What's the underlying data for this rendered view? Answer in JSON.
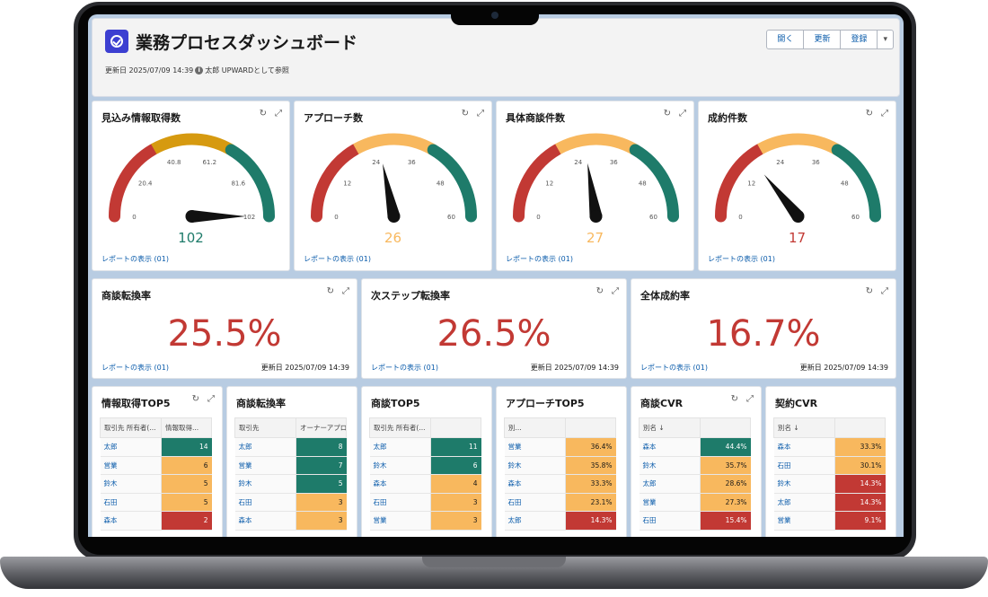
{
  "colors": {
    "red": "#c23934",
    "orange": "#f8b85e",
    "green": "#1e7b6a",
    "gold": "#d69a10",
    "link": "#0b5cab"
  },
  "header": {
    "title": "業務プロセスダッシュボード",
    "updated": "更新日 2025/07/09 14:39",
    "viewer": "太郎 UPWARDとして参照",
    "buttons": {
      "open": "開く",
      "refresh": "更新",
      "subscribe": "登録"
    }
  },
  "link_label": "レポートの表示 (01)",
  "date_label": "更新日 2025/07/09 14:39",
  "gauges": [
    {
      "title": "見込み情報取得数",
      "value": 102,
      "display": "102",
      "min": 0,
      "max": 102,
      "ticks": [
        "0",
        "20.4",
        "40.8",
        "61.2",
        "81.6",
        "102"
      ],
      "segments": [
        "red",
        "gold",
        "green"
      ],
      "value_color": "green"
    },
    {
      "title": "アプローチ数",
      "value": 26,
      "display": "26",
      "min": 0,
      "max": 60,
      "ticks": [
        "0",
        "12",
        "24",
        "36",
        "48",
        "60"
      ],
      "segments": [
        "red",
        "orange",
        "green"
      ],
      "value_color": "orange"
    },
    {
      "title": "具体商談件数",
      "value": 27,
      "display": "27",
      "min": 0,
      "max": 60,
      "ticks": [
        "0",
        "12",
        "24",
        "36",
        "48",
        "60"
      ],
      "segments": [
        "red",
        "orange",
        "green"
      ],
      "value_color": "orange"
    },
    {
      "title": "成約件数",
      "value": 17,
      "display": "17",
      "min": 0,
      "max": 60,
      "ticks": [
        "0",
        "12",
        "24",
        "36",
        "48",
        "60"
      ],
      "segments": [
        "red",
        "orange",
        "green"
      ],
      "value_color": "red"
    }
  ],
  "metrics": [
    {
      "title": "商談転換率",
      "value": "25.5%"
    },
    {
      "title": "次ステップ転換率",
      "value": "26.5%"
    },
    {
      "title": "全体成約率",
      "value": "16.7%"
    }
  ],
  "tables": [
    {
      "title": "情報取得TOP5",
      "headers": [
        "取引先 所有者(...",
        "情報取得..."
      ],
      "rows": [
        [
          "太郎",
          "14",
          "green"
        ],
        [
          "営業",
          "6",
          "orange"
        ],
        [
          "鈴木",
          "5",
          "orange"
        ],
        [
          "石田",
          "5",
          "orange"
        ],
        [
          "森本",
          "2",
          "red"
        ]
      ]
    },
    {
      "title": "商談転換率",
      "headers": [
        "取引先",
        "オーナーアプロ..."
      ],
      "rows": [
        [
          "太郎",
          "8",
          "green"
        ],
        [
          "営業",
          "7",
          "green"
        ],
        [
          "鈴木",
          "5",
          "green"
        ],
        [
          "石田",
          "3",
          "orange"
        ],
        [
          "森本",
          "3",
          "orange"
        ]
      ]
    },
    {
      "title": "商談TOP5",
      "headers": [
        "取引先 所有者(...",
        ""
      ],
      "rows": [
        [
          "太郎",
          "11",
          "green"
        ],
        [
          "鈴木",
          "6",
          "green"
        ],
        [
          "森本",
          "4",
          "orange"
        ],
        [
          "石田",
          "3",
          "orange"
        ],
        [
          "営業",
          "3",
          "orange"
        ]
      ]
    },
    {
      "title": "アプローチTOP5",
      "headers": [
        "別...",
        ""
      ],
      "rows": [
        [
          "営業",
          "36.4%",
          "orange"
        ],
        [
          "鈴木",
          "35.8%",
          "orange"
        ],
        [
          "森本",
          "33.3%",
          "orange"
        ],
        [
          "石田",
          "23.1%",
          "orange"
        ],
        [
          "太郎",
          "14.3%",
          "red"
        ]
      ]
    },
    {
      "title": "商談CVR",
      "headers": [
        "別名 ↓",
        ""
      ],
      "rows": [
        [
          "森本",
          "44.4%",
          "green"
        ],
        [
          "鈴木",
          "35.7%",
          "orange"
        ],
        [
          "太郎",
          "28.6%",
          "orange"
        ],
        [
          "営業",
          "27.3%",
          "orange"
        ],
        [
          "石田",
          "15.4%",
          "red"
        ]
      ]
    },
    {
      "title": "契約CVR",
      "headers": [
        "別名 ↓",
        ""
      ],
      "rows": [
        [
          "森本",
          "33.3%",
          "orange"
        ],
        [
          "石田",
          "30.1%",
          "orange"
        ],
        [
          "鈴木",
          "14.3%",
          "red"
        ],
        [
          "太郎",
          "14.3%",
          "red"
        ],
        [
          "営業",
          "9.1%",
          "red"
        ]
      ]
    }
  ]
}
